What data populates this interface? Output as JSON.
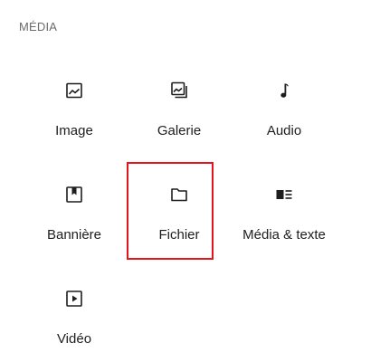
{
  "section": {
    "title": "MÉDIA"
  },
  "blocks": [
    {
      "label": "Image",
      "icon": "image-icon"
    },
    {
      "label": "Galerie",
      "icon": "gallery-icon"
    },
    {
      "label": "Audio",
      "icon": "audio-note-icon"
    },
    {
      "label": "Bannière",
      "icon": "cover-bookmark-icon"
    },
    {
      "label": "Fichier",
      "icon": "folder-icon",
      "selected": true
    },
    {
      "label": "Média & texte",
      "icon": "media-text-icon"
    },
    {
      "label": "Vidéo",
      "icon": "video-play-icon"
    }
  ],
  "colors": {
    "selection_border": "#e3141b",
    "label": "#1e1e1e",
    "section_title": "#6b6b6b"
  }
}
